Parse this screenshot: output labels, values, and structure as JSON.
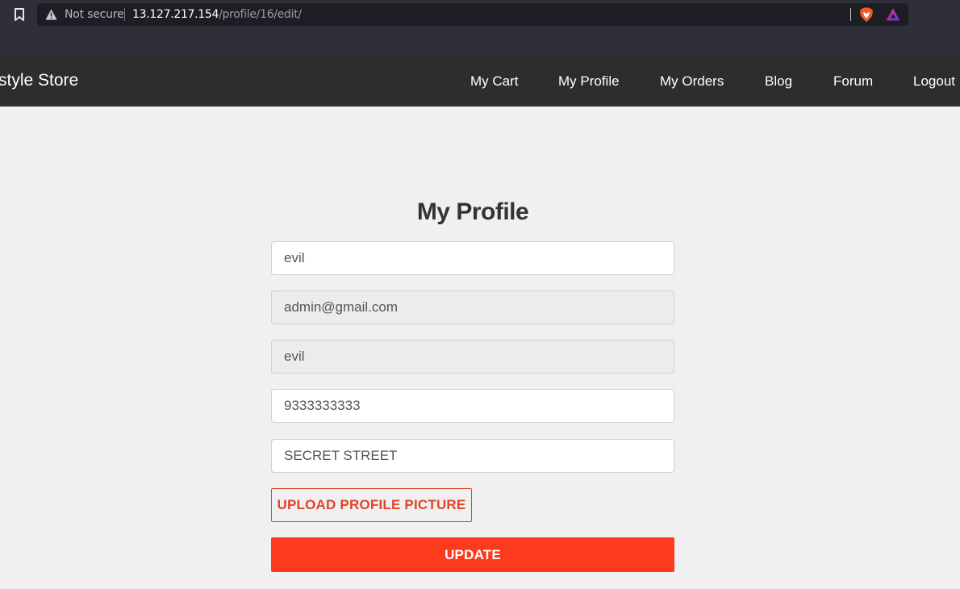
{
  "browser": {
    "security_label": "Not secure",
    "url_host": "13.127.217.154",
    "url_path": "/profile/16/edit/",
    "icons": [
      "bookmark-icon",
      "warning-icon",
      "brave-shield-icon",
      "brave-rewards-icon"
    ]
  },
  "navbar": {
    "brand": "style Store",
    "links": [
      {
        "label": "My Cart"
      },
      {
        "label": "My Profile"
      },
      {
        "label": "My Orders"
      },
      {
        "label": "Blog"
      },
      {
        "label": "Forum"
      },
      {
        "label": "Logout"
      }
    ]
  },
  "form": {
    "title": "My Profile",
    "fields": [
      {
        "value": "evil",
        "readonly": false
      },
      {
        "value": "admin@gmail.com",
        "readonly": true
      },
      {
        "value": "evil",
        "readonly": true
      },
      {
        "value": "9333333333",
        "readonly": false
      },
      {
        "value": "SECRET STREET",
        "readonly": false
      }
    ],
    "upload_label": "UPLOAD PROFILE PICTURE",
    "update_label": "UPDATE"
  },
  "colors": {
    "accent": "#fe3a1e",
    "accent_outline": "#e0452b",
    "navbar_bg": "#2d2d2d",
    "page_bg": "#f0f0f0"
  }
}
